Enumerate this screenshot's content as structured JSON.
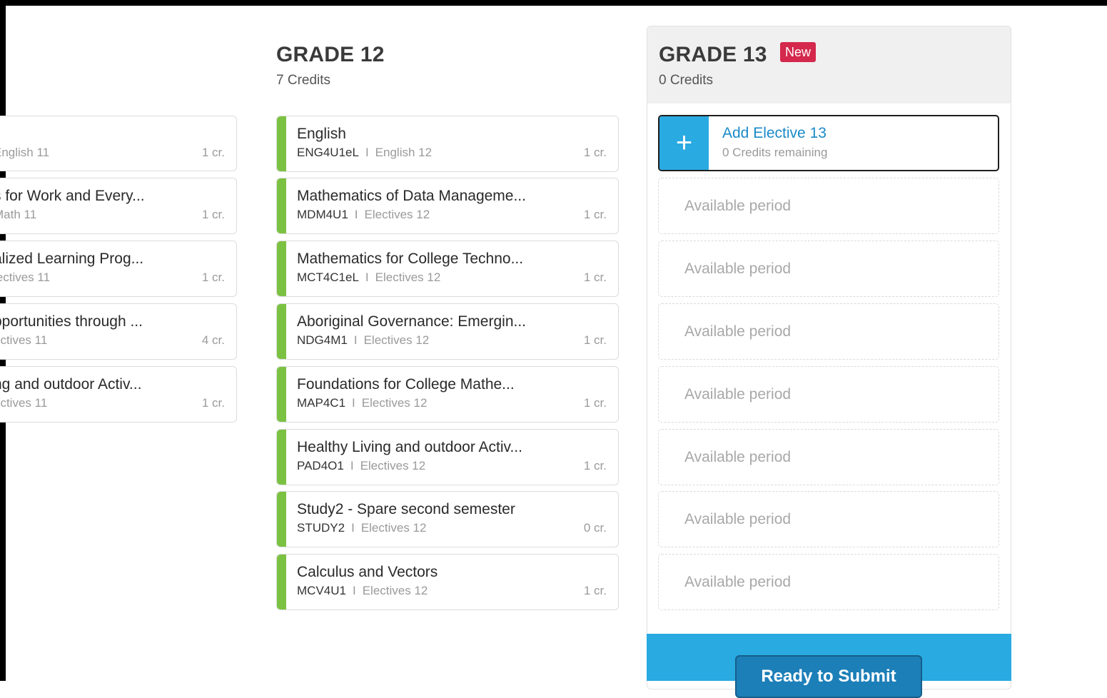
{
  "grade11": {
    "courses": [
      {
        "name": "",
        "code": "",
        "category": "English 11",
        "credits": "1 cr."
      },
      {
        "name": "s for Work and Every...",
        "code": "",
        "category": "Math 11",
        "credits": "1 cr."
      },
      {
        "name": "alized Learning Prog...",
        "code": "",
        "category": "lectives 11",
        "credits": "1 cr."
      },
      {
        "name": "pportunities through ...",
        "code": "",
        "category": "ectives 11",
        "credits": "4 cr."
      },
      {
        "name": "ng and outdoor Activ...",
        "code": "",
        "category": "ectives 11",
        "credits": "1 cr."
      }
    ]
  },
  "grade12": {
    "title": "GRADE 12",
    "credits": "7 Credits",
    "separator": "I",
    "courses": [
      {
        "name": "English",
        "code": "ENG4U1eL",
        "category": "English 12",
        "credits": "1 cr."
      },
      {
        "name": "Mathematics of Data Manageme...",
        "code": "MDM4U1",
        "category": "Electives 12",
        "credits": "1 cr."
      },
      {
        "name": "Mathematics for College Techno...",
        "code": "MCT4C1eL",
        "category": "Electives 12",
        "credits": "1 cr."
      },
      {
        "name": "Aboriginal Governance: Emergin...",
        "code": "NDG4M1",
        "category": "Electives 12",
        "credits": "1 cr."
      },
      {
        "name": "Foundations for College Mathe...",
        "code": "MAP4C1",
        "category": "Electives 12",
        "credits": "1 cr."
      },
      {
        "name": "Healthy Living and outdoor Activ...",
        "code": "PAD4O1",
        "category": "Electives 12",
        "credits": "1 cr."
      },
      {
        "name": "Study2 - Spare second semester",
        "code": "STUDY2",
        "category": "Electives 12",
        "credits": "0 cr."
      },
      {
        "name": "Calculus and Vectors",
        "code": "MCV4U1",
        "category": "Electives 12",
        "credits": "1 cr."
      }
    ]
  },
  "grade13": {
    "title": "GRADE 13",
    "badge": "New",
    "credits": "0 Credits",
    "add_elective": {
      "title": "Add Elective 13",
      "subtitle": "0 Credits remaining",
      "icon": "+"
    },
    "periods": [
      "Available period",
      "Available period",
      "Available period",
      "Available period",
      "Available period",
      "Available period",
      "Available period"
    ],
    "submit_label": "Ready to Submit"
  },
  "colors": {
    "accent_green": "#7cc242",
    "primary_blue": "#29aae1",
    "badge_red": "#d4284c"
  }
}
